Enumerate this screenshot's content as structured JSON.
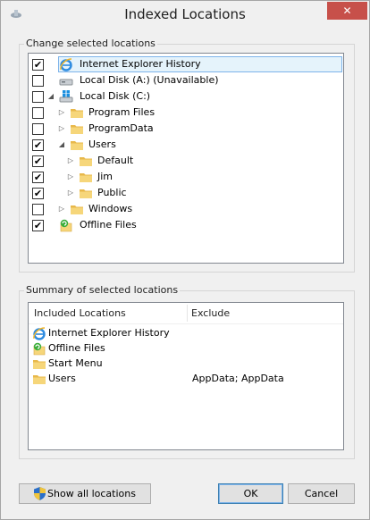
{
  "window": {
    "title": "Indexed Locations",
    "close_label": "✕"
  },
  "change_group": {
    "label": "Change selected locations"
  },
  "tree": [
    {
      "label": "Internet Explorer History",
      "checked": true,
      "icon": "ie-icon",
      "expander": "",
      "level": 0,
      "selected": true
    },
    {
      "label": "Local Disk (A:) (Unavailable)",
      "checked": false,
      "icon": "drive-icon",
      "expander": "",
      "level": 0,
      "selected": false
    },
    {
      "label": "Local Disk (C:)",
      "checked": false,
      "icon": "windows-drive-icon",
      "expander": "◢",
      "level": 0,
      "selected": false
    },
    {
      "label": "Program Files",
      "checked": false,
      "icon": "folder-icon",
      "expander": "▷",
      "level": 1,
      "selected": false
    },
    {
      "label": "ProgramData",
      "checked": false,
      "icon": "folder-icon",
      "expander": "▷",
      "level": 1,
      "selected": false
    },
    {
      "label": "Users",
      "checked": true,
      "icon": "folder-icon",
      "expander": "◢",
      "level": 1,
      "selected": false
    },
    {
      "label": "Default",
      "checked": true,
      "icon": "folder-icon",
      "expander": "▷",
      "level": 2,
      "selected": false
    },
    {
      "label": "Jim",
      "checked": true,
      "icon": "folder-icon",
      "expander": "▷",
      "level": 2,
      "selected": false
    },
    {
      "label": "Public",
      "checked": true,
      "icon": "folder-icon",
      "expander": "▷",
      "level": 2,
      "selected": false
    },
    {
      "label": "Windows",
      "checked": false,
      "icon": "folder-icon",
      "expander": "▷",
      "level": 1,
      "selected": false
    },
    {
      "label": "Offline Files",
      "checked": true,
      "icon": "offline-files-icon",
      "expander": "",
      "level": 0,
      "selected": false
    }
  ],
  "summary_group": {
    "label": "Summary of selected locations"
  },
  "summary": {
    "columns": [
      "Included Locations",
      "Exclude"
    ],
    "rows": [
      {
        "location": "Internet Explorer History",
        "exclude": "",
        "icon": "ie-icon"
      },
      {
        "location": "Offline Files",
        "exclude": "",
        "icon": "offline-files-icon"
      },
      {
        "location": "Start Menu",
        "exclude": "",
        "icon": "folder-icon"
      },
      {
        "location": "Users",
        "exclude": "AppData; AppData",
        "icon": "folder-icon"
      }
    ]
  },
  "buttons": {
    "show_all": "Show all locations",
    "ok": "OK",
    "cancel": "Cancel"
  },
  "colors": {
    "selection_bg": "#e5f3fb",
    "selection_border": "#7eb4ea",
    "close_button": "#c7504a",
    "folder": "#f4cf6a"
  }
}
